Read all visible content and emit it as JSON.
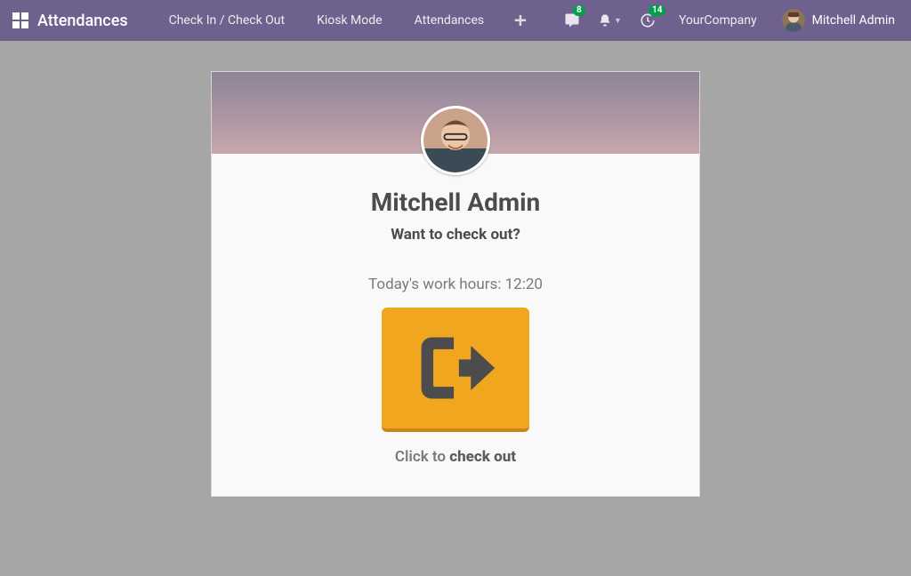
{
  "nav": {
    "brand": "Attendances",
    "links": [
      "Check In / Check Out",
      "Kiosk Mode",
      "Attendances"
    ],
    "company": "YourCompany",
    "user": "Mitchell Admin",
    "messages_badge": "8",
    "activities_badge": "14"
  },
  "card": {
    "employee_name": "Mitchell Admin",
    "prompt": "Want to check out?",
    "hours_label": "Today's work hours: ",
    "hours_value": "12:20",
    "click_hint_prefix": "Click to ",
    "click_hint_strong": "check out"
  },
  "colors": {
    "navbar": "#6e618e",
    "accent": "#f0a71f",
    "badge": "#00a04a"
  }
}
